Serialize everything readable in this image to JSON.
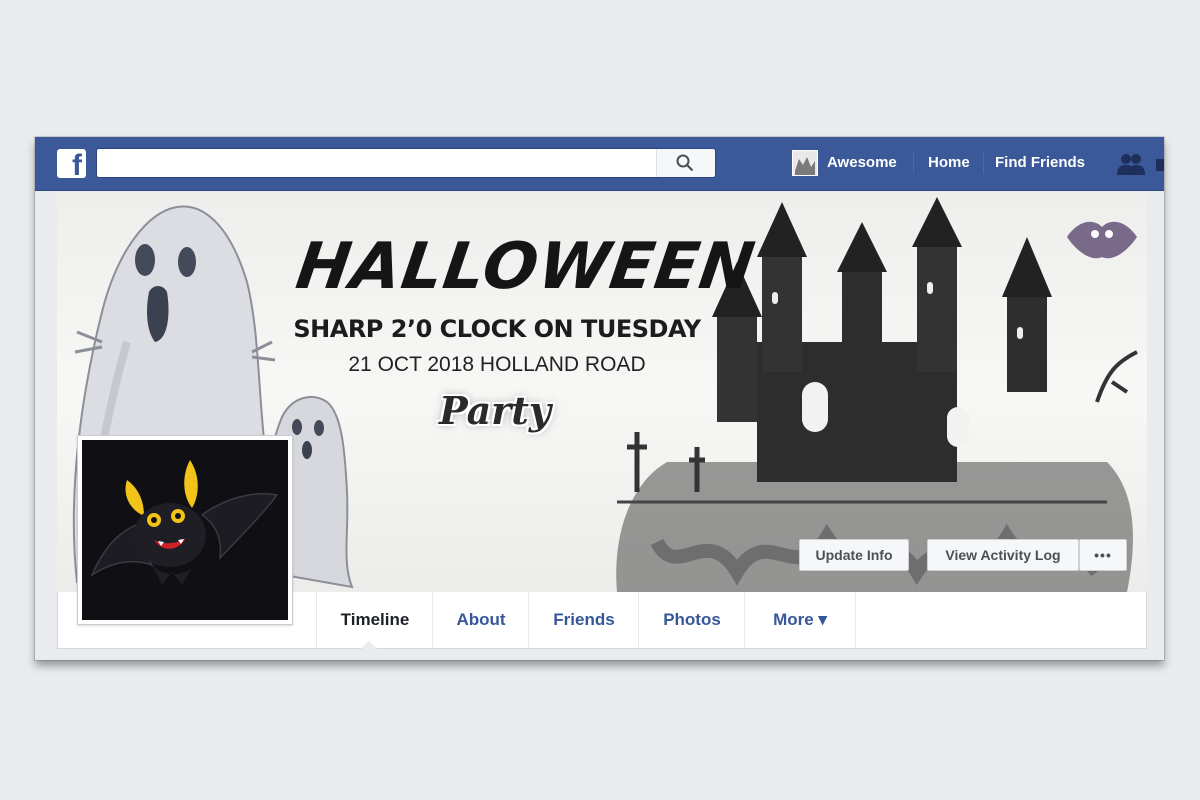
{
  "topbar": {
    "logo": "f",
    "search": {
      "placeholder": "",
      "value": ""
    },
    "profile_name": "Awesome",
    "links": [
      "Home",
      "Find Friends"
    ],
    "icons": [
      "facebook-logo-icon",
      "search-icon",
      "friend-requests-icon"
    ]
  },
  "cover": {
    "title": "HALLOWEEN",
    "subtitle": "SHARP 2’0 CLOCK ON TUESDAY",
    "details": "21 OCT 2018 HOLLAND ROAD",
    "script_word": "Party",
    "buttons": {
      "update_info": "Update Info",
      "activity_log": "View Activity Log",
      "more": "•••"
    }
  },
  "tabs": [
    {
      "label": "Timeline",
      "active": true
    },
    {
      "label": "About",
      "active": false
    },
    {
      "label": "Friends",
      "active": false
    },
    {
      "label": "Photos",
      "active": false
    },
    {
      "label": "More ▾",
      "active": false
    }
  ],
  "colors": {
    "brand": "#3b5998",
    "link": "#365899",
    "background": "#e9ebee"
  }
}
